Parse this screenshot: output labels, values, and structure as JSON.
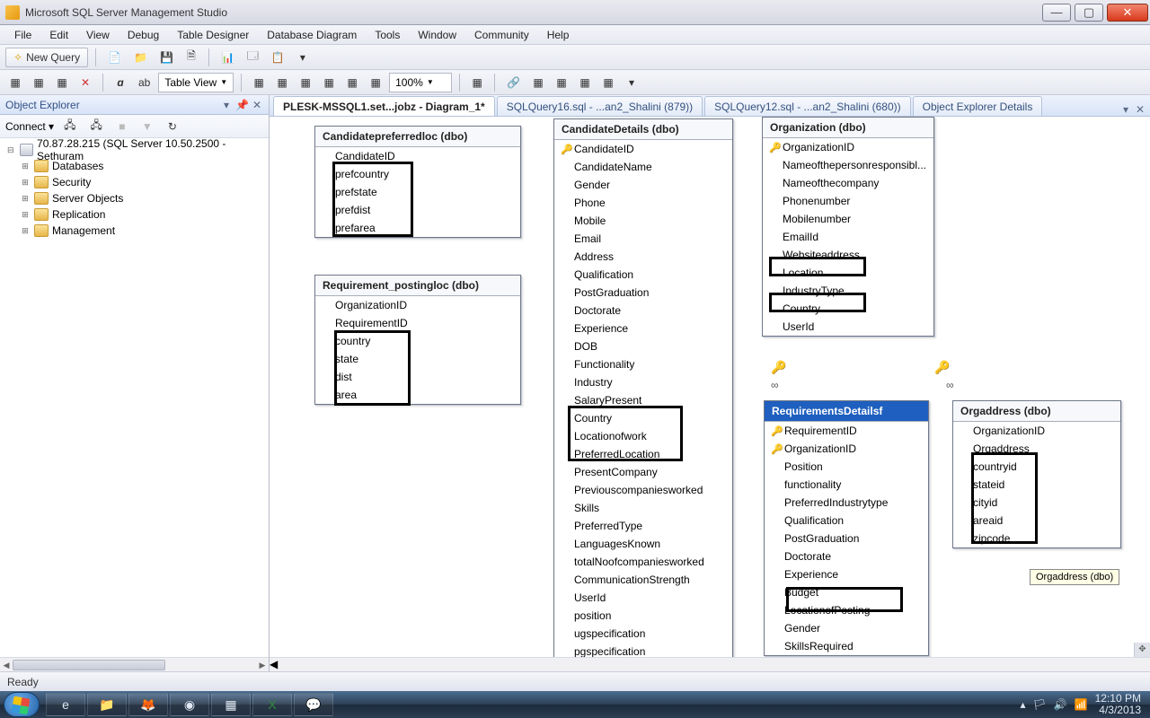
{
  "app_title": "Microsoft SQL Server Management Studio",
  "menu": [
    "File",
    "Edit",
    "View",
    "Debug",
    "Table Designer",
    "Database Diagram",
    "Tools",
    "Window",
    "Community",
    "Help"
  ],
  "toolbar1": {
    "new_query": "New Query"
  },
  "toolbar2": {
    "table_view": "Table View",
    "zoom": "100%"
  },
  "explorer": {
    "title": "Object Explorer",
    "connect": "Connect",
    "server": "70.87.28.215 (SQL Server 10.50.2500 - Sethuram",
    "nodes": [
      "Databases",
      "Security",
      "Server Objects",
      "Replication",
      "Management"
    ]
  },
  "tabs": {
    "t1": "PLESK-MSSQL1.set...jobz - Diagram_1*",
    "t2": "SQLQuery16.sql - ...an2_Shalini (879))",
    "t3": "SQLQuery12.sql - ...an2_Shalini (680))",
    "t4": "Object Explorer Details"
  },
  "tables": {
    "pref": {
      "title": "Candidatepreferredloc (dbo)",
      "cols": [
        "CandidateID",
        "prefcountry",
        "prefstate",
        "prefdist",
        "prefarea"
      ]
    },
    "reqloc": {
      "title": "Requirement_postingloc (dbo)",
      "cols": [
        "OrganizationID",
        "RequirementID",
        "country",
        "state",
        "dist",
        "area"
      ]
    },
    "cand": {
      "title": "CandidateDetails (dbo)",
      "cols": [
        "CandidateID",
        "CandidateName",
        "Gender",
        "Phone",
        "Mobile",
        "Email",
        "Address",
        "Qualification",
        "PostGraduation",
        "Doctorate",
        "Experience",
        "DOB",
        "Functionality",
        "Industry",
        "SalaryPresent",
        "Country",
        "Locationofwork",
        "PreferredLocation",
        "PresentCompany",
        "Previouscompaniesworked",
        "Skills",
        "PreferredType",
        "LanguagesKnown",
        "totalNoofcompaniesworked",
        "CommunicationStrength",
        "UserId",
        "position",
        "ugspecification",
        "pgspecification"
      ]
    },
    "org": {
      "title": "Organization (dbo)",
      "cols": [
        "OrganizationID",
        "Nameofthepersonresponsibl...",
        "Nameofthecompany",
        "Phonenumber",
        "Mobilenumber",
        "EmailId",
        "Websiteaddress",
        "Location",
        "IndustryType",
        "Country",
        "UserId"
      ]
    },
    "reqd": {
      "title": "RequirementsDetailsf",
      "cols": [
        "RequirementID",
        "OrganizationID",
        "Position",
        "functionality",
        "PreferredIndustrytype",
        "Qualification",
        "PostGraduation",
        "Doctorate",
        "Experience",
        "Budget",
        "LocationofPosting",
        "Gender",
        "SkillsRequired"
      ]
    },
    "orgaddr": {
      "title": "Orgaddress (dbo)",
      "cols": [
        "OrganizationID",
        "Orgaddress",
        "countryid",
        "stateid",
        "cityid",
        "areaid",
        "zipcode"
      ]
    }
  },
  "tooltip": "Orgaddress (dbo)",
  "status": "Ready",
  "clock": {
    "time": "12:10 PM",
    "date": "4/3/2013"
  }
}
